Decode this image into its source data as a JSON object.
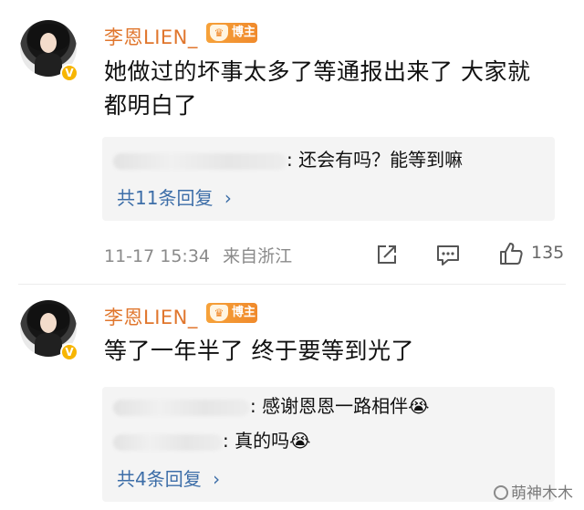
{
  "comments": [
    {
      "username": "李恩LIEN_",
      "badge": "博主",
      "text_line1": "她做过的坏事太多了等通报出来了  大家就",
      "text_line2": "都明白了",
      "replies": [
        {
          "text": ": 还会有吗？能等到嘛"
        }
      ],
      "more_replies": "共11条回复",
      "date": "11-17 15:34",
      "location": "来自浙江",
      "likes": "135"
    },
    {
      "username": "李恩LIEN_",
      "badge": "博主",
      "text_line1": "等了一年半了  终于要等到光了",
      "replies": [
        {
          "text": ": 感谢恩恩一路相伴😭"
        },
        {
          "text": ": 真的吗😭"
        }
      ],
      "more_replies": "共4条回复"
    }
  ],
  "watermark": "萌神木木",
  "icons": {
    "verified": "verified-v-icon",
    "share": "share-icon",
    "comment": "comment-icon",
    "like": "thumbs-up-icon",
    "chevron": "chevron-right-icon"
  },
  "colors": {
    "username": "#e0762d",
    "badge": "#f08a2c",
    "link": "#3d6ea8",
    "meta": "#8a8a8a",
    "reply_bg": "#f4f4f4"
  }
}
